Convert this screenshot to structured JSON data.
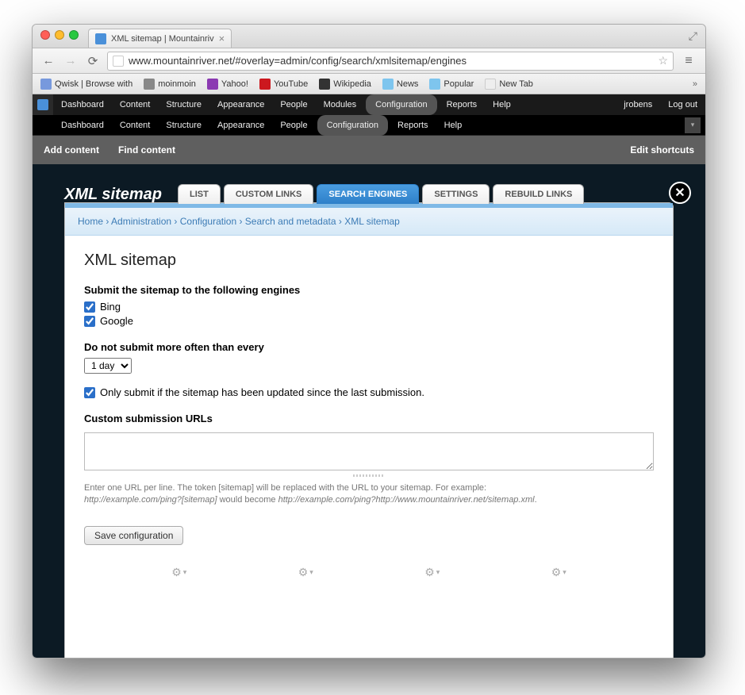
{
  "tab": {
    "title": "XML sitemap | Mountainriv"
  },
  "address": "www.mountainriver.net/#overlay=admin/config/search/xmlsitemap/engines",
  "bookmarks": [
    "Qwisk | Browse with",
    "moinmoin",
    "Yahoo!",
    "YouTube",
    "Wikipedia",
    "News",
    "Popular",
    "New Tab"
  ],
  "admin1": {
    "items": [
      "Dashboard",
      "Content",
      "Structure",
      "Appearance",
      "People",
      "Modules",
      "Configuration",
      "Reports",
      "Help"
    ],
    "active": "Configuration",
    "user": "jrobens",
    "logout": "Log out"
  },
  "admin2": {
    "items": [
      "Dashboard",
      "Content",
      "Structure",
      "Appearance",
      "People",
      "Configuration",
      "Reports",
      "Help"
    ],
    "active": "Configuration"
  },
  "shortcuts": {
    "add": "Add content",
    "find": "Find content",
    "edit": "Edit shortcuts"
  },
  "overlay": {
    "page_title": "XML sitemap",
    "tabs": [
      "LIST",
      "CUSTOM LINKS",
      "SEARCH ENGINES",
      "SETTINGS",
      "REBUILD LINKS"
    ],
    "active_tab": "SEARCH ENGINES",
    "breadcrumb": [
      "Home",
      "Administration",
      "Configuration",
      "Search and metadata",
      "XML sitemap"
    ],
    "heading": "XML sitemap",
    "engines_label": "Submit the sitemap to the following engines",
    "engines": [
      {
        "name": "Bing",
        "checked": true
      },
      {
        "name": "Google",
        "checked": true
      }
    ],
    "freq_label": "Do not submit more often than every",
    "freq_value": "1 day",
    "only_if_updated": {
      "checked": true,
      "label": "Only submit if the sitemap has been updated since the last submission."
    },
    "custom_urls_label": "Custom submission URLs",
    "custom_urls_value": "",
    "help_line1": "Enter one URL per line. The token [sitemap] will be replaced with the URL to your sitemap. For example:",
    "help_ex1": "http://example.com/ping?[sitemap]",
    "help_mid": " would become ",
    "help_ex2": "http://example.com/ping?http://www.mountainriver.net/sitemap.xml",
    "help_end": ".",
    "save_label": "Save configuration"
  }
}
